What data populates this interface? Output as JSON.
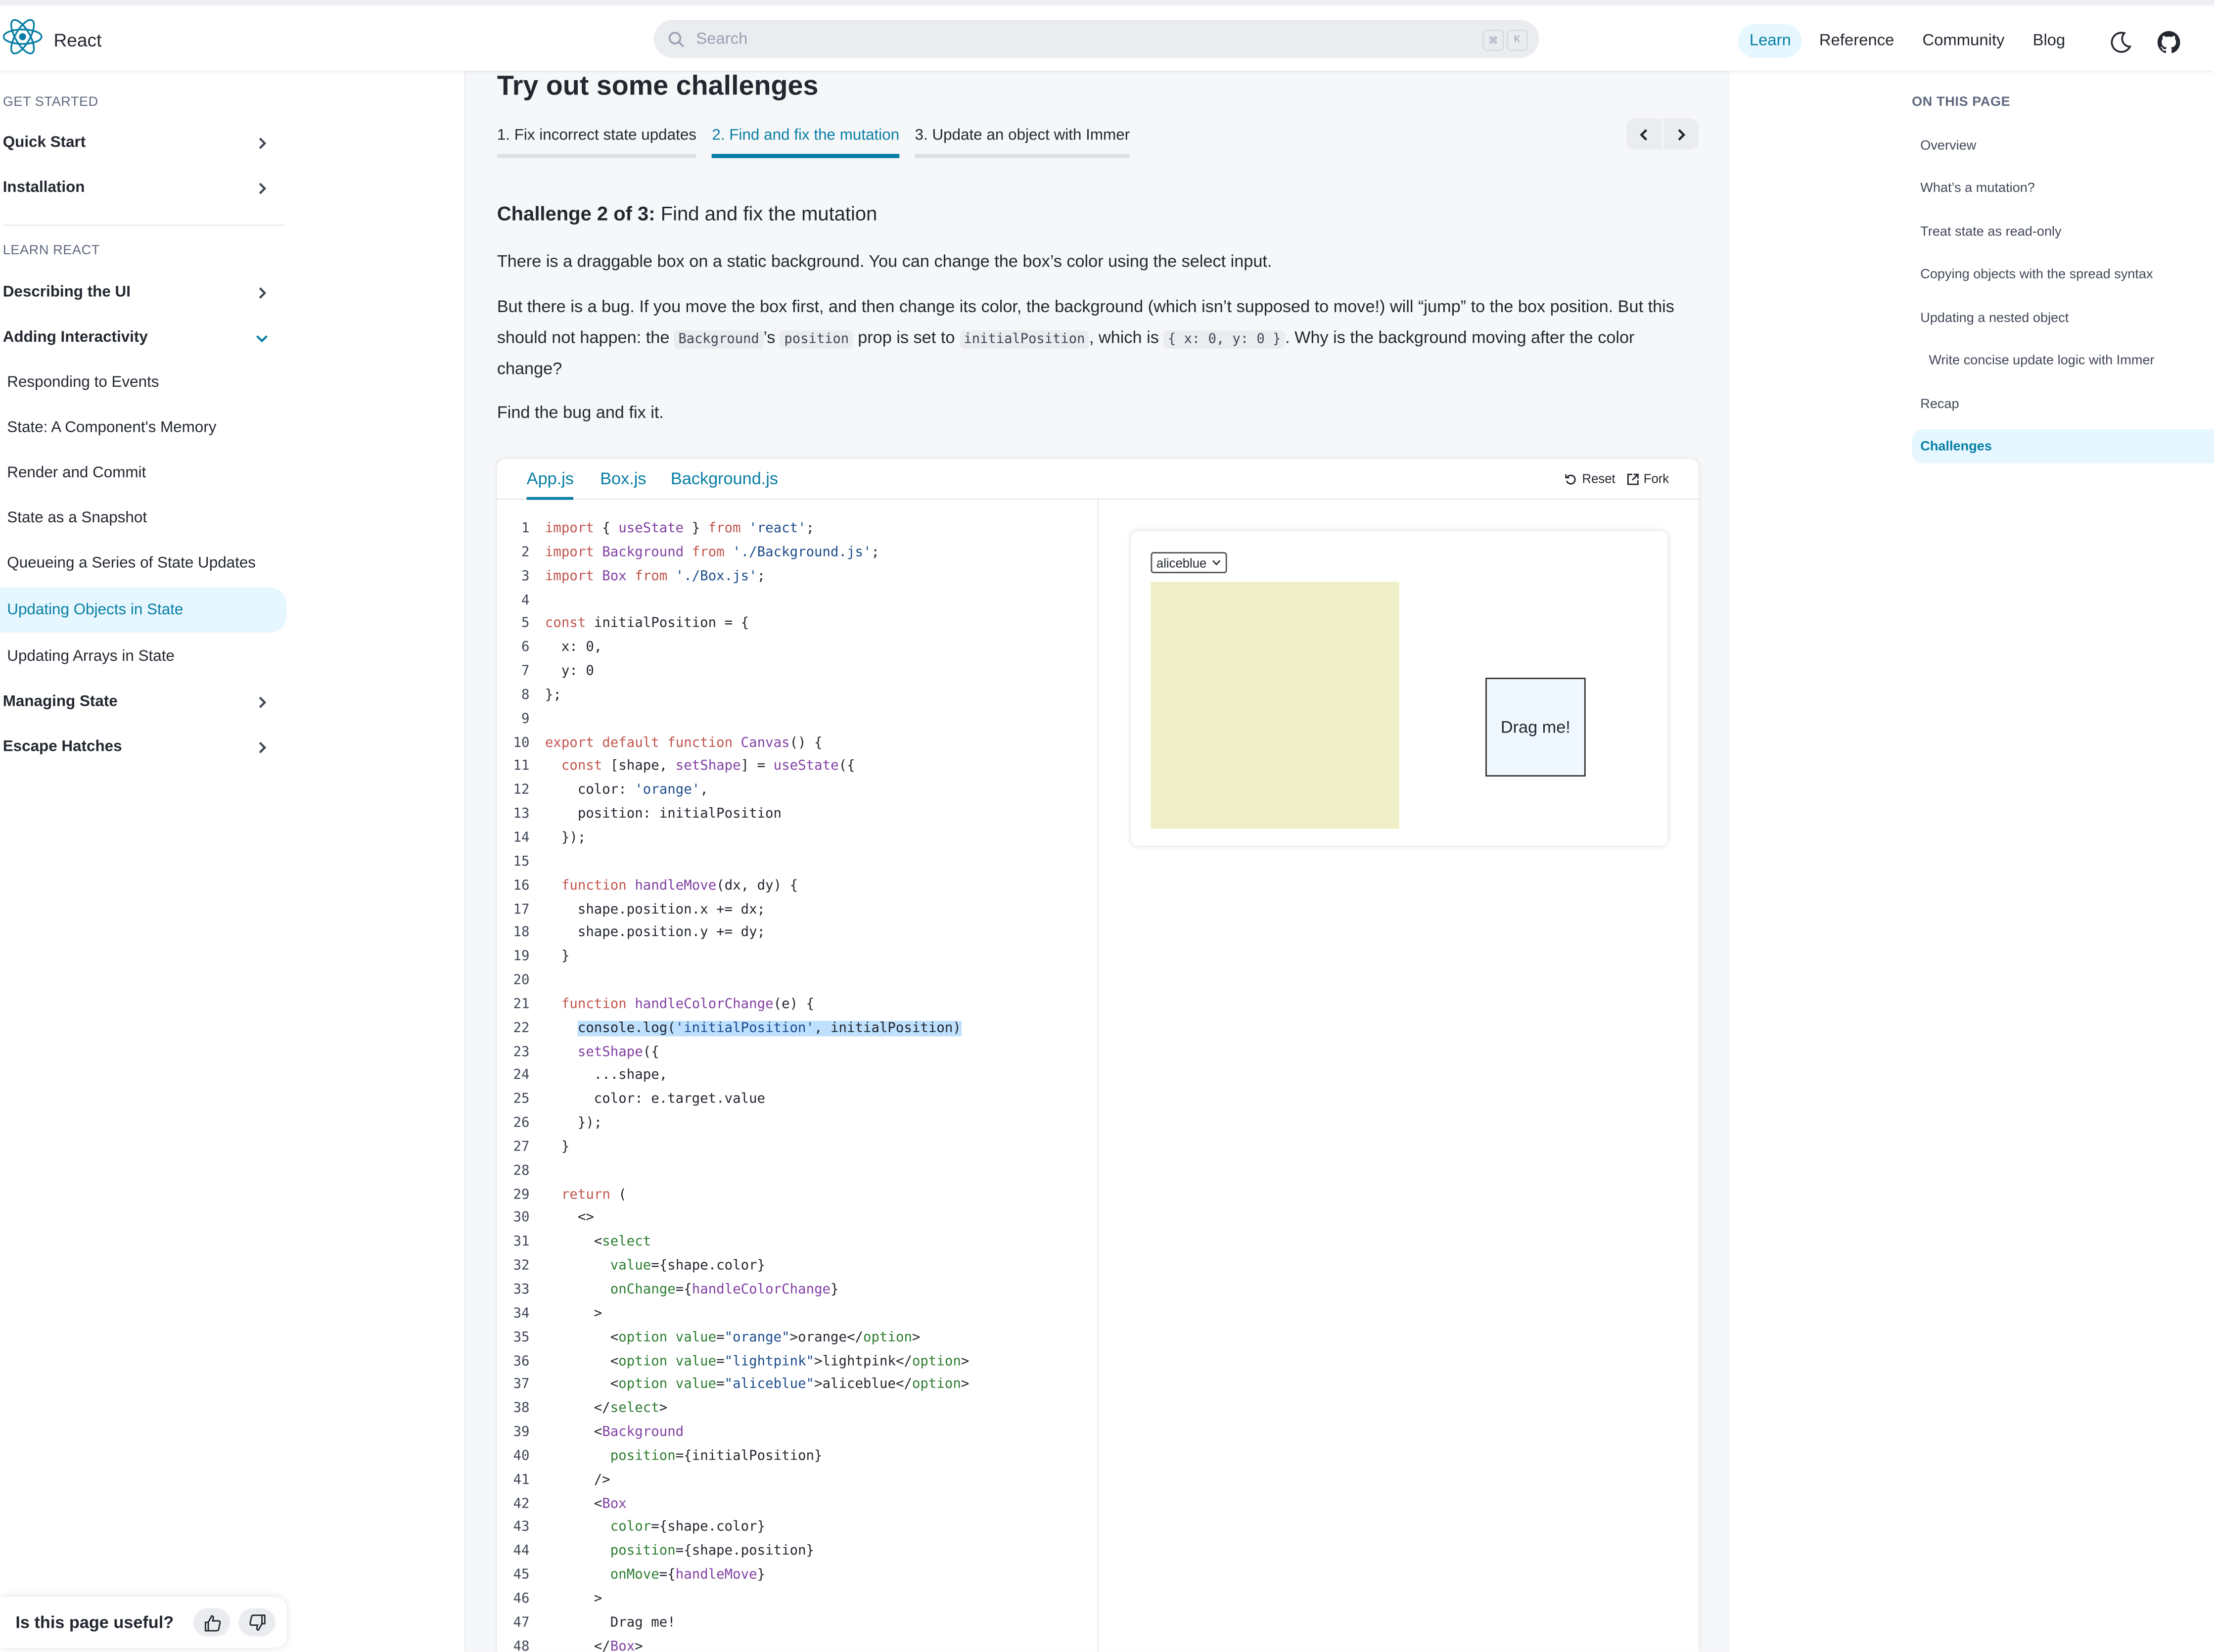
{
  "colors": {
    "accent": "#087ea4",
    "accent_bg": "#e6f7ff",
    "text": "#23272f"
  },
  "header": {
    "brand": "React",
    "search_placeholder": "Search",
    "kbd": [
      "⌘",
      "K"
    ],
    "nav": [
      "Learn",
      "Reference",
      "Community",
      "Blog"
    ],
    "active_nav": "Learn",
    "icons": [
      "react-logo-icon",
      "search-icon",
      "moon-icon",
      "github-icon"
    ]
  },
  "sidebar": {
    "get_started_title": "GET STARTED",
    "quick_start": "Quick Start",
    "installation": "Installation",
    "learn_title": "LEARN REACT",
    "describing": "Describing the UI",
    "adding": "Adding Interactivity",
    "sub": [
      "Responding to Events",
      "State: A Component's Memory",
      "Render and Commit",
      "State as a Snapshot",
      "Queueing a Series of State Updates",
      "Updating Objects in State",
      "Updating Arrays in State"
    ],
    "managing": "Managing State",
    "escape": "Escape Hatches"
  },
  "feedback": {
    "label": "Is this page useful?"
  },
  "main": {
    "heading": "Try out some challenges",
    "tabs": [
      "1. Fix incorrect state updates",
      "2. Find and fix the mutation",
      "3. Update an object with Immer"
    ],
    "challenge_prefix": "Challenge 2 of 3:",
    "challenge_name": "Find and fix the mutation",
    "p1": "There is a draggable box on a static background. You can change the box’s color using the select input.",
    "p2a": "But there is a bug. If you move the box first, and then change its color, the background (which isn’t supposed to move!) will “jump” to the box position. But this should not happen: the ",
    "p2_code1": "Background",
    "p2b": "’s ",
    "p2_code2": "position",
    "p2c": " prop is set to ",
    "p2_code3": "initialPosition",
    "p2d": ", which is ",
    "p2_code4": "{ x: 0, y: 0 }",
    "p2e": ". Why is the background moving after the color change?",
    "p3": "Find the bug and fix it."
  },
  "sandbox": {
    "files": [
      "App.js",
      "Box.js",
      "Background.js"
    ],
    "reset": "Reset",
    "fork": "Fork",
    "code": [
      "import { useState } from 'react';",
      "import Background from './Background.js';",
      "import Box from './Box.js';",
      "",
      "const initialPosition = {",
      "  x: 0,",
      "  y: 0",
      "};",
      "",
      "export default function Canvas() {",
      "  const [shape, setShape] = useState({",
      "    color: 'orange',",
      "    position: initialPosition",
      "  });",
      "",
      "  function handleMove(dx, dy) {",
      "    shape.position.x += dx;",
      "    shape.position.y += dy;",
      "  }",
      "",
      "  function handleColorChange(e) {",
      "    console.log('initialPosition', initialPosition)",
      "    setShape({",
      "      ...shape,",
      "      color: e.target.value",
      "    });",
      "  }",
      "",
      "  return (",
      "    <>",
      "      <select",
      "        value={shape.color}",
      "        onChange={handleColorChange}",
      "      >",
      "        <option value=\"orange\">orange</option>",
      "        <option value=\"lightpink\">lightpink</option>",
      "        <option value=\"aliceblue\">aliceblue</option>",
      "      </select>",
      "      <Background",
      "        position={initialPosition}",
      "      />",
      "      <Box",
      "        color={shape.color}",
      "        position={shape.position}",
      "        onMove={handleMove}",
      "      >",
      "        Drag me!",
      "      </Box>"
    ],
    "preview": {
      "select_value": "aliceblue",
      "drag_label": "Drag me!"
    }
  },
  "toc": {
    "title": "ON THIS PAGE",
    "items": [
      "Overview",
      "What’s a mutation?",
      "Treat state as read-only",
      "Copying objects with the spread syntax",
      "Updating a nested object",
      "Write concise update logic with Immer",
      "Recap",
      "Challenges"
    ],
    "active": "Challenges"
  }
}
